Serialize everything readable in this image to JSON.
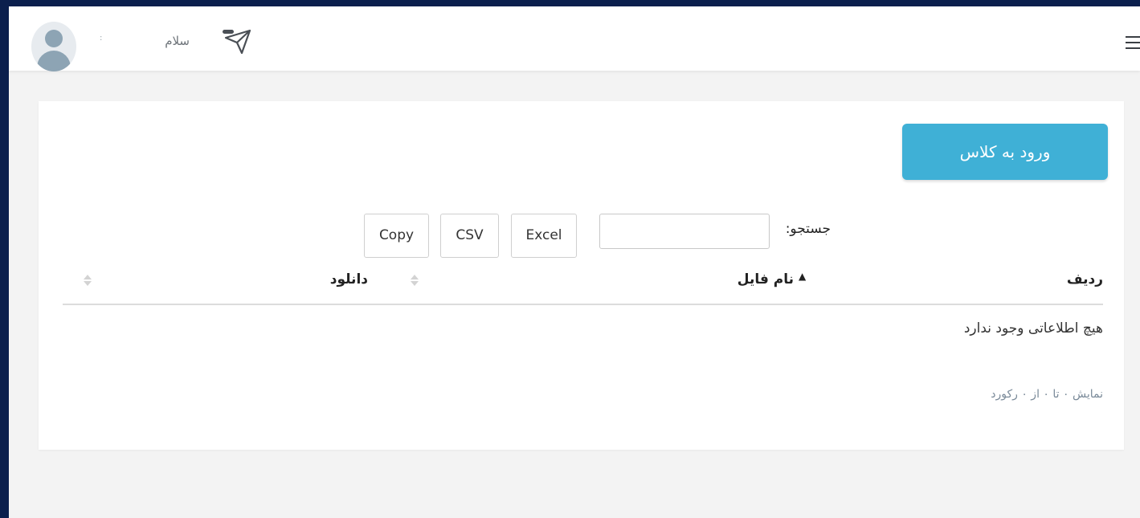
{
  "header": {
    "username": ":",
    "greeting": "سلام"
  },
  "main": {
    "enter_class_label": "ورود به کلاس",
    "search_label": "جستجو:",
    "search_value": "",
    "export_buttons": {
      "excel": "Excel",
      "csv": "CSV",
      "copy": "Copy"
    },
    "table": {
      "columns": [
        "ردیف",
        "نام فایل",
        "دانلود"
      ],
      "empty_message": "هیچ اطلاعاتی وجود ندارد",
      "info": "نمایش ۰ تا ۰ از ۰ رکورد"
    }
  },
  "colors": {
    "frame": "#0b1f4d",
    "accent": "#3fb0d6"
  },
  "icons": [
    "avatar-icon",
    "send-icon",
    "menu-icon",
    "sort-asc-icon",
    "sort-icon"
  ]
}
